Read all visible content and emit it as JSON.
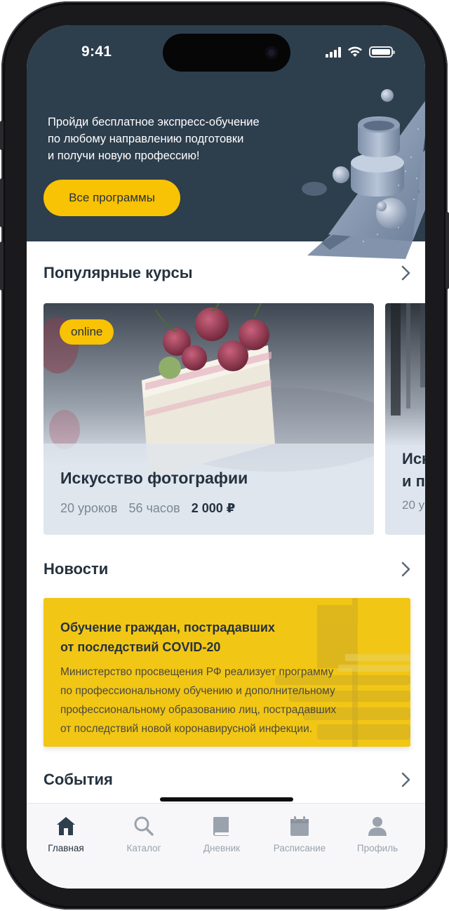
{
  "status_bar": {
    "time": "9:41"
  },
  "hero": {
    "text_lines": [
      "Пройди бесплатное экспресс-обучение",
      "по любому направлению подготовки",
      "и получи новую профессию!"
    ],
    "button_label": "Все программы"
  },
  "popular": {
    "title": "Популярные курсы",
    "cards": [
      {
        "badge": "online",
        "title": "Искусство фотографии",
        "lessons": "20 уроков",
        "hours": "56 часов",
        "price": "2 000 ₽"
      },
      {
        "title_line1": "Иск",
        "title_line2": "и п",
        "meta": "20 у"
      }
    ]
  },
  "news": {
    "title": "Новости",
    "card": {
      "title_line1": "Обучение граждан, пострадавших",
      "title_line2": "от последствий COVID-20",
      "body_lines": [
        "Министерство просвещения РФ реализует программу",
        "по профессиональному обучению и дополнительному",
        "профессиональному образованию лиц, пострадавших",
        "от последствий новой коронавирусной инфекции."
      ]
    }
  },
  "events": {
    "title": "События"
  },
  "tabbar": {
    "items": [
      {
        "label": "Главная",
        "icon": "home-icon",
        "active": true
      },
      {
        "label": "Каталог",
        "icon": "search-icon",
        "active": false
      },
      {
        "label": "Дневник",
        "icon": "book-icon",
        "active": false
      },
      {
        "label": "Расписание",
        "icon": "calendar-icon",
        "active": false
      },
      {
        "label": "Профиль",
        "icon": "profile-icon",
        "active": false
      }
    ]
  },
  "colors": {
    "hero_bg": "#2d3e4d",
    "accent_yellow": "#f8c205",
    "text_dark": "#25323f",
    "text_muted": "#7b8794",
    "tab_inactive": "#9aa3ad"
  }
}
